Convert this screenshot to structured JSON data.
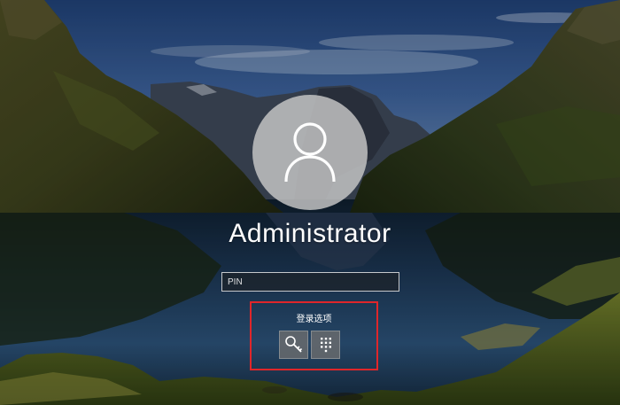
{
  "user": {
    "name": "Administrator"
  },
  "pin_input": {
    "placeholder": "PIN",
    "value": ""
  },
  "sign_in_options": {
    "label": "登录选项",
    "buttons": [
      {
        "icon": "key-icon",
        "kind": "password"
      },
      {
        "icon": "keypad-icon",
        "kind": "pin"
      }
    ]
  },
  "colors": {
    "highlight_box": "#e0262a",
    "text": "#ffffff"
  }
}
